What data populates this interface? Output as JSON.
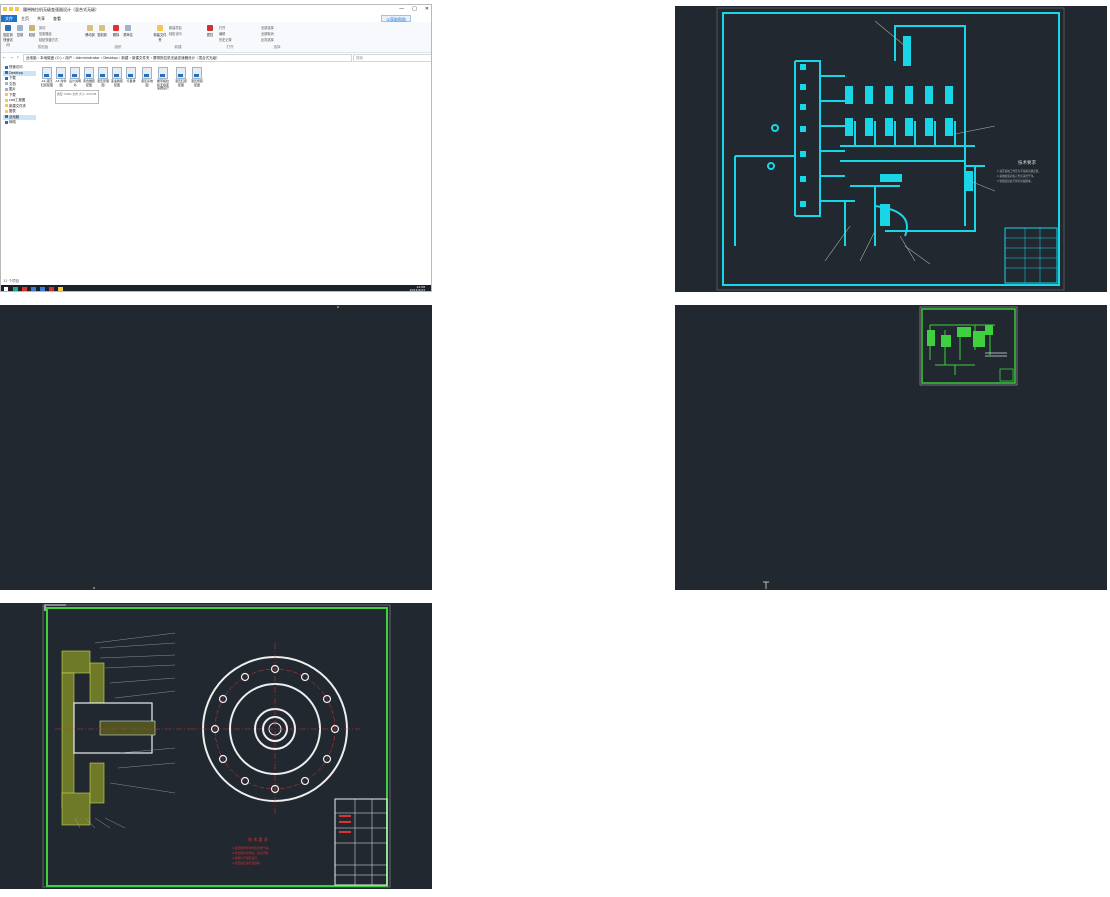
{
  "explorer": {
    "window_title": "履带拖拉机无级变速器设计（混合式无级）",
    "window_controls": [
      "—",
      "□",
      "✕"
    ],
    "tabs": [
      "文件",
      "主页",
      "共享",
      "查看"
    ],
    "help_label": "①获取帮助",
    "ribbon": {
      "groups": [
        "剪贴板",
        "组织",
        "新建",
        "打开",
        "选择"
      ],
      "pin_label": "固定到快速访问",
      "copy_label": "复制",
      "paste_label": "粘贴",
      "cut_label": "剪切",
      "copy_path_label": "复制路径",
      "paste_shortcut_label": "粘贴快捷方式",
      "move_to_label": "移动到",
      "copy_to_label": "复制到",
      "delete_label": "删除",
      "rename_label": "重命名",
      "new_folder_label": "新建文件夹",
      "new_item_label": "新建项目",
      "easy_access_label": "轻松访问",
      "properties_label": "属性",
      "open_label": "打开",
      "edit_label": "编辑",
      "history_label": "历史记录",
      "select_all_label": "全部选择",
      "select_none_label": "全部取消",
      "invert_label": "反向选择"
    },
    "address": {
      "nav_buttons": "← → ↑",
      "path": "此电脑 › 本地磁盘 (C:) › 用户 › Administrator › Desktop › 新建 › 新建文件夹 › 履带拖拉机无级变速器设计（混合式无级）",
      "search_placeholder": "搜索"
    },
    "nav_pane": [
      "快速访问",
      "Desktop",
      "下载",
      "文档",
      "图片",
      "下载",
      "cad工程图",
      "新建文件夹",
      "图表",
      "此电脑",
      "网络"
    ],
    "files": [
      "A2-液压缸装配图",
      "A3-零件图",
      "设计说明书",
      "离合器装配图",
      "液压原理图",
      "变速箱装配图",
      "行星排",
      "液压系统图",
      "履带拖拉机无级变速器设计",
      "液压缸装配图",
      "液压泵装配图"
    ],
    "tooltip": "类型: DWG 文件 大小: 220 KB",
    "status": "11 个项目",
    "tray_time": "12:08",
    "tray_date": "2023/4/23"
  },
  "cad1": {
    "tech_title": "技术要求",
    "tech_lines": [
      "1.液压系统工作压力不得超过额定值。",
      "2.系统组装前各元件应清洗干净。",
      "3.管路连接处不得有渗漏现象。"
    ]
  },
  "cad4": {
    "tech_title": "技 术 要 求",
    "tech_lines": [
      "1.装配前所有零件应清洗干净。",
      "2.离合器分离彻底，接合平稳。",
      "3.摩擦片不得有油污。",
      "4.装配后应进行试运转。"
    ]
  },
  "colors": {
    "cad_background": "#212830",
    "cyan_lines": "#19d6e6",
    "green_lines": "#3ed03e",
    "accent_blue": "#1a73c9"
  }
}
